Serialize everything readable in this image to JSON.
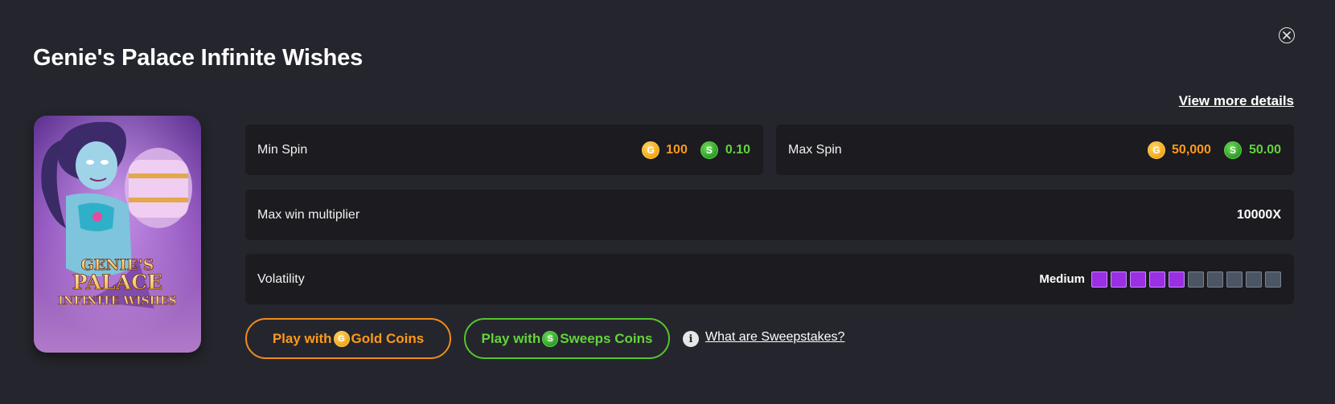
{
  "title": "Genie's Palace Infinite Wishes",
  "view_more": "View more details",
  "thumbnail": {
    "logo_line1": "GENIE'S",
    "logo_line2": "PALACE",
    "logo_line3": "INFINITE WISHES"
  },
  "min_spin": {
    "label": "Min Spin",
    "gold": "100",
    "sweeps": "0.10"
  },
  "max_spin": {
    "label": "Max Spin",
    "gold": "50,000",
    "sweeps": "50.00"
  },
  "max_win": {
    "label": "Max win multiplier",
    "value": "10000X"
  },
  "volatility": {
    "label": "Volatility",
    "level_text": "Medium",
    "level": 5,
    "max": 10
  },
  "buttons": {
    "gold": {
      "prefix": "Play with",
      "suffix": "Gold Coins"
    },
    "sweeps": {
      "prefix": "Play with",
      "suffix": "Sweeps Coins"
    }
  },
  "sweeps_link": "What are Sweepstakes?",
  "icons": {
    "gold_coin": "G",
    "sweeps_coin": "S",
    "info": "i",
    "close": "close-icon"
  },
  "colors": {
    "background": "#25262d",
    "card": "#1b1b20",
    "gold": "#ff9a1a",
    "sweeps": "#63d43a",
    "volatility_on": "#9a2fe3",
    "volatility_off": "#4b5563"
  }
}
